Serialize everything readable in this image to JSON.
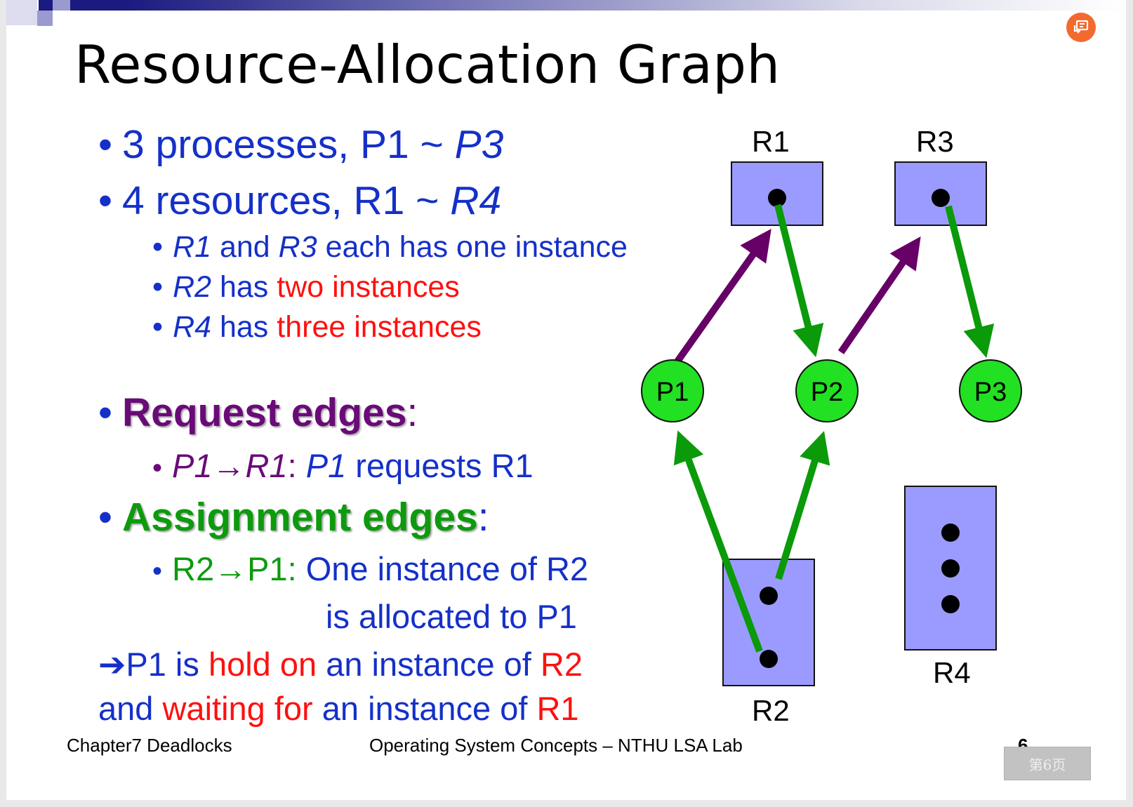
{
  "slide": {
    "title": "Resource-Allocation Graph",
    "bullets": {
      "b1": {
        "a": "3 processes, P1 ~ ",
        "b": "P3"
      },
      "b2": {
        "a": "4 resources, R1 ~ ",
        "b": "R4"
      },
      "s1": {
        "a": "R1",
        "b": " and ",
        "c": "R3",
        "d": " each has one instance"
      },
      "s2": {
        "a": "R2",
        "b": " has ",
        "c": "two instances"
      },
      "s3": {
        "a": "R4",
        "b": " has ",
        "c": "three instances"
      },
      "request": {
        "label": "Request edges",
        "colon": ":"
      },
      "request_sub": {
        "a": "P1",
        "arrow": "→",
        "b": "R1",
        "c": ": ",
        "d": "P1",
        "e": " requests R1"
      },
      "assign": {
        "label": "Assignment edges",
        "colon": ":"
      },
      "assign_sub": {
        "a": "R2",
        "arrow": "→",
        "b": "P1: ",
        "c": "One instance of R2"
      },
      "assign_sub2": "is allocated to P1",
      "conclusion1": {
        "arrow": "➔",
        "a": "P1 is ",
        "b": "hold on",
        "c": " an instance of ",
        "d": "R2"
      },
      "conclusion2": {
        "a": "and ",
        "b": "waiting for",
        "c": " an instance of ",
        "d": "R1"
      }
    },
    "graph": {
      "processes": [
        "P1",
        "P2",
        "P3"
      ],
      "resources": [
        "R1",
        "R2",
        "R3",
        "R4"
      ],
      "request_edges": [
        [
          "P1",
          "R1"
        ],
        [
          "P2",
          "R3"
        ]
      ],
      "assignment_edges": [
        [
          "R1",
          "P2"
        ],
        [
          "R3",
          "P3"
        ],
        [
          "R2",
          "P1"
        ],
        [
          "R2",
          "P2"
        ]
      ],
      "colors": {
        "process_fill": "#22e022",
        "resource_fill": "#9b9bff",
        "request": "#660066",
        "assignment": "#0a9a0a"
      }
    },
    "footer": {
      "left": "Chapter7 Deadlocks",
      "center": "Operating System Concepts – NTHU LSA Lab",
      "page": "6"
    }
  },
  "viewer": {
    "page_button": "第6页",
    "icon": "present-icon",
    "accent": "#f26a2e"
  }
}
